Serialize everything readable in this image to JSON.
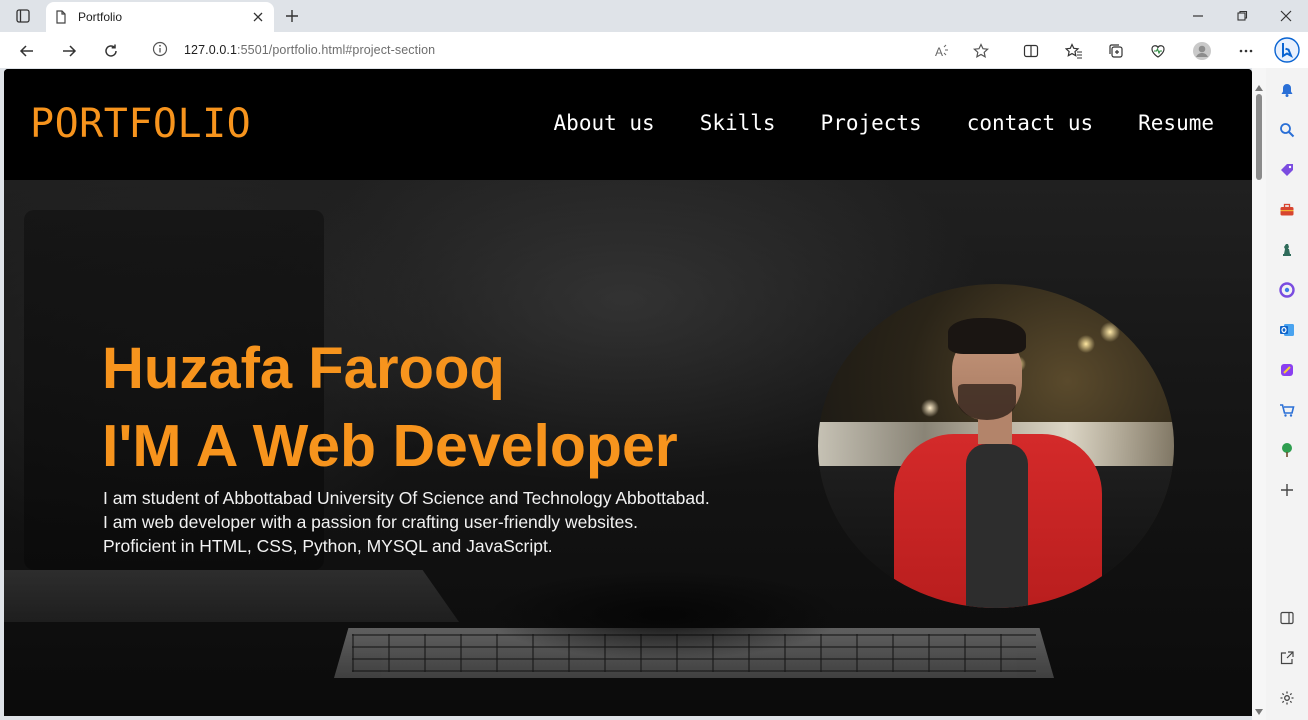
{
  "browser": {
    "tab": {
      "title": "Portfolio"
    },
    "address": {
      "url_host": "127.0.0.1",
      "url_rest": ":5501/portfolio.html#project-section"
    },
    "toolbar_icons": [
      "read-aloud-icon",
      "favorite-star-icon",
      "split-screen-icon",
      "favorites-icon",
      "collections-icon",
      "browser-essentials-icon",
      "profile-icon",
      "more-icon",
      "copilot-icon"
    ],
    "sidebar_icons": [
      "bell-icon",
      "search-icon",
      "tag-icon",
      "toolbox-icon",
      "chess-icon",
      "m365-icon",
      "outlook-icon",
      "designer-icon",
      "shopping-icon",
      "tree-icon",
      "add-icon"
    ],
    "accent": "#0a64d2"
  },
  "site": {
    "logo": "PORTFOLIO",
    "nav": [
      "About us",
      "Skills",
      "Projects",
      "contact us",
      "Resume"
    ],
    "hero": {
      "name": "Huzafa Farooq",
      "role": "I'M A Web Developer",
      "description": [
        "I am student of Abbottabad University Of Science and Technology Abbottabad.",
        "I am web developer with a passion for crafting user-friendly websites.",
        "Proficient in HTML, CSS, Python, MYSQL and JavaScript."
      ]
    },
    "colors": {
      "accent": "#f7941d",
      "header_bg": "#000000",
      "nav_text": "#ffffff"
    }
  }
}
